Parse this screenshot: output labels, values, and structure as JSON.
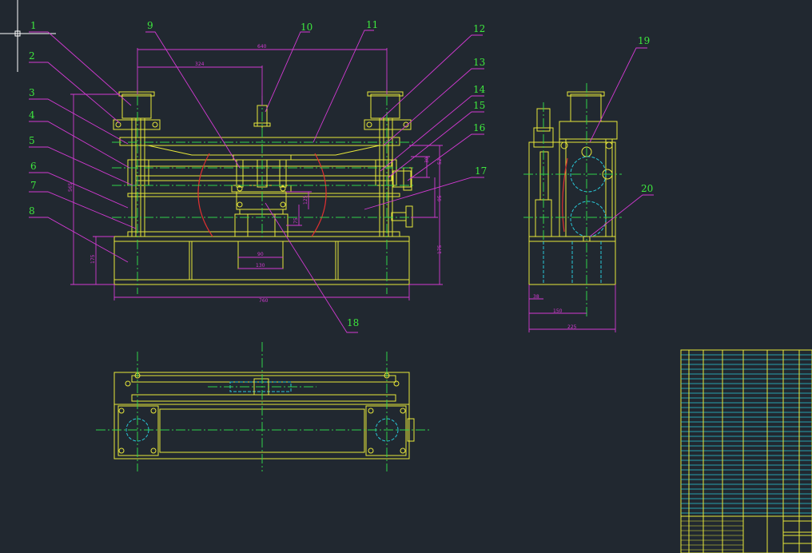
{
  "balloons": [
    {
      "id": "b1",
      "text": "1"
    },
    {
      "id": "b2",
      "text": "2"
    },
    {
      "id": "b3",
      "text": "3"
    },
    {
      "id": "b4",
      "text": "4"
    },
    {
      "id": "b5",
      "text": "5"
    },
    {
      "id": "b6",
      "text": "6"
    },
    {
      "id": "b7",
      "text": "7"
    },
    {
      "id": "b8",
      "text": "8"
    },
    {
      "id": "b9",
      "text": "9"
    },
    {
      "id": "b10",
      "text": "10"
    },
    {
      "id": "b11",
      "text": "11"
    },
    {
      "id": "b12",
      "text": "12"
    },
    {
      "id": "b13",
      "text": "13"
    },
    {
      "id": "b14",
      "text": "14"
    },
    {
      "id": "b15",
      "text": "15"
    },
    {
      "id": "b16",
      "text": "16"
    },
    {
      "id": "b17",
      "text": "17"
    },
    {
      "id": "b18",
      "text": "18"
    },
    {
      "id": "b19",
      "text": "19"
    },
    {
      "id": "b20",
      "text": "20"
    }
  ],
  "dimensions": {
    "top_width": "640",
    "half_width": "324",
    "total_height": "565",
    "base_height": "175",
    "base_width": "760",
    "right_height_a": "52",
    "right_height_b": "95",
    "right_height_c": "175",
    "right_small": "30",
    "center_a": "90",
    "center_b": "130",
    "center_v1": "125",
    "center_v2": "75",
    "left_small": "175",
    "side_a": "38",
    "side_b": "150",
    "side_c": "225"
  },
  "colors": {
    "background": "#212830",
    "outline": "#e8e83a",
    "centerline": "#2fd24a",
    "hidden": "#29c8d8",
    "dimension": "#d23ad2",
    "section": "#e03030",
    "label": "#3ee83e"
  }
}
